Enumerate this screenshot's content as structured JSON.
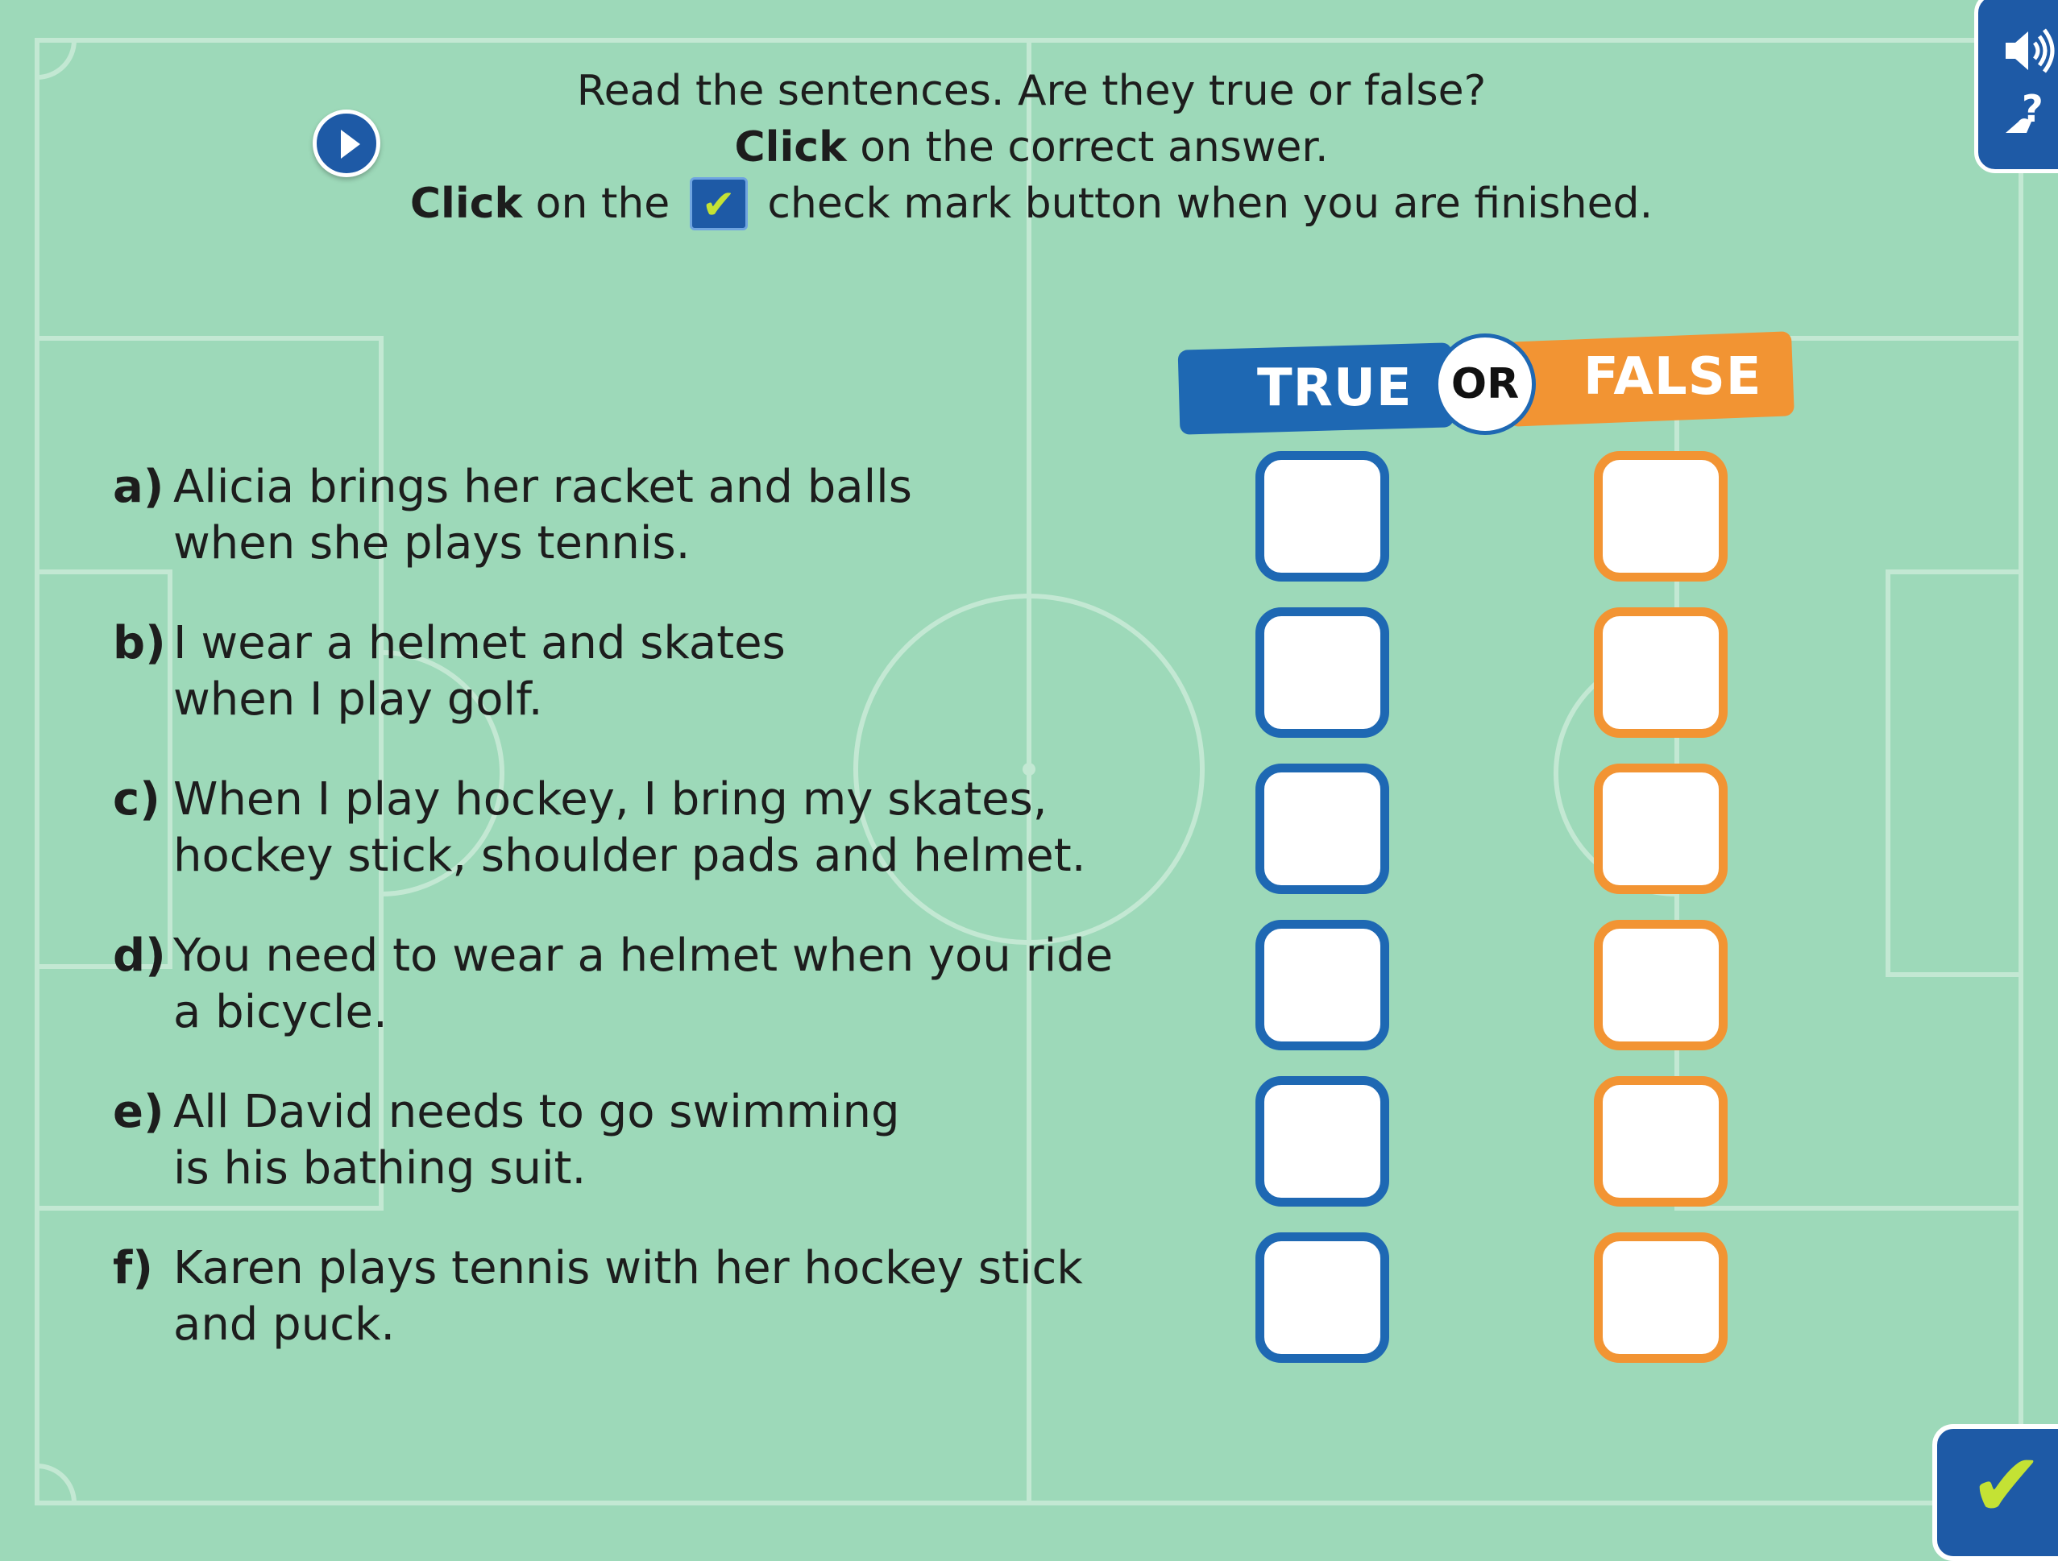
{
  "instructions": {
    "line1": "Read the sentences. Are they true or false?",
    "line2_bold": "Click",
    "line2_rest": " on the correct answer.",
    "line3_bold": "Click",
    "line3_mid": " on the ",
    "line3_icon": "✔",
    "line3_rest": " check mark button when you are finished."
  },
  "controls": {
    "play_icon": "play-icon",
    "audio_icon": "speaker-icon",
    "help_icon": "help-icon",
    "check_label": "✔"
  },
  "banner": {
    "true_label": "TRUE",
    "or_label": "OR",
    "false_label": "FALSE"
  },
  "questions": [
    {
      "letter": "a)",
      "line1": "Alicia brings her racket and balls",
      "line2": "when she plays tennis."
    },
    {
      "letter": "b)",
      "line1": "I wear a helmet and skates",
      "line2": "when I play golf."
    },
    {
      "letter": "c)",
      "line1": "When I play hockey, I bring my skates,",
      "line2": "hockey stick, shoulder pads and helmet."
    },
    {
      "letter": "d)",
      "line1": "You need to wear a helmet when you ride",
      "line2": "a bicycle."
    },
    {
      "letter": "e)",
      "line1": "All David needs to go swimming",
      "line2": "is his bathing suit."
    },
    {
      "letter": "f)",
      "line1": "Karen plays tennis with her hockey stick",
      "line2": "and puck."
    }
  ],
  "colors": {
    "field": "#9dd9b9",
    "field_lines": "#c3e8d3",
    "true_blue": "#1e68b3",
    "false_orange": "#f29433",
    "check_green": "#c4e234"
  }
}
